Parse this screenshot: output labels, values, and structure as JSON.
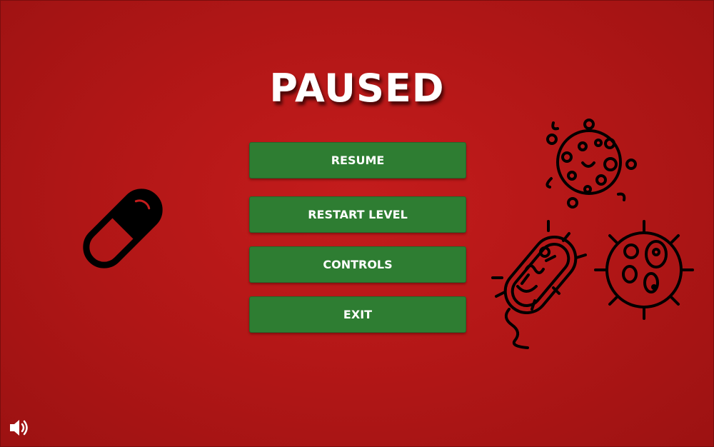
{
  "screen": {
    "title": "PAUSED",
    "background_color": "#b41717",
    "button_color": "#2e7d32"
  },
  "menu": {
    "resume_label": "RESUME",
    "restart_label": "RESTART LEVEL",
    "controls_label": "CONTROLS",
    "exit_label": "EXIT"
  },
  "icons": {
    "pill": "pill-icon",
    "virus": "virus-icon",
    "bacteria": "bacteria-icon",
    "cell": "cell-icon",
    "sound": "speaker-icon"
  }
}
